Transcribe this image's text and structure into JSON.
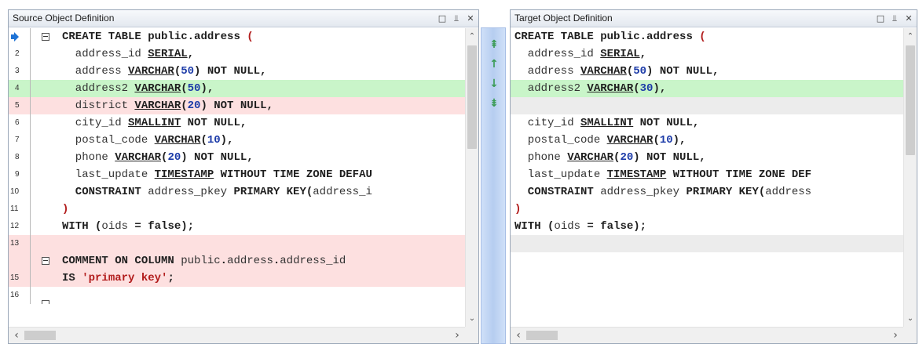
{
  "source_panel": {
    "title": "Source Object Definition"
  },
  "target_panel": {
    "title": "Target Object Definition"
  },
  "window_buttons": {
    "restore": "□",
    "pin": "⫫",
    "close": "✕"
  },
  "scroll": {
    "up": "⌃",
    "down": "⌄",
    "left": "‹",
    "right": "›"
  },
  "nav_buttons": {
    "first": "⇞",
    "prev": "↑",
    "next": "↓",
    "last": "⇟"
  },
  "colors": {
    "added": "#c9f5c9",
    "removed": "#fde0e0",
    "blank": "#ececec",
    "marker": "#1e73d6"
  },
  "source_lines": [
    {
      "num": "",
      "state": "normal",
      "fold": true,
      "marker": true,
      "segments": [
        {
          "t": "CREATE TABLE ",
          "c": "kw"
        },
        {
          "t": "public",
          "c": "kw"
        },
        {
          "t": ".",
          "c": "kw"
        },
        {
          "t": "address",
          "c": "kw"
        },
        {
          "t": " (",
          "c": "pr"
        }
      ]
    },
    {
      "num": "2",
      "state": "normal",
      "segments": [
        {
          "t": "  address_id ",
          "c": "id"
        },
        {
          "t": "SERIAL",
          "c": "ty"
        },
        {
          "t": ",",
          "c": "kw"
        }
      ]
    },
    {
      "num": "3",
      "state": "normal",
      "segments": [
        {
          "t": "  address ",
          "c": "id"
        },
        {
          "t": "VARCHAR",
          "c": "ty"
        },
        {
          "t": "(",
          "c": "kw"
        },
        {
          "t": "50",
          "c": "num"
        },
        {
          "t": ") NOT NULL,",
          "c": "kw"
        }
      ]
    },
    {
      "num": "4",
      "state": "added",
      "segments": [
        {
          "t": "  address2 ",
          "c": "id"
        },
        {
          "t": "VARCHAR",
          "c": "ty"
        },
        {
          "t": "(",
          "c": "kw"
        },
        {
          "t": "50",
          "c": "num"
        },
        {
          "t": "),",
          "c": "kw"
        }
      ]
    },
    {
      "num": "5",
      "state": "removed",
      "segments": [
        {
          "t": "  district ",
          "c": "id"
        },
        {
          "t": "VARCHAR",
          "c": "ty"
        },
        {
          "t": "(",
          "c": "kw"
        },
        {
          "t": "20",
          "c": "num"
        },
        {
          "t": ") NOT NULL,",
          "c": "kw"
        }
      ]
    },
    {
      "num": "6",
      "state": "normal",
      "segments": [
        {
          "t": "  city_id ",
          "c": "id"
        },
        {
          "t": "SMALLINT",
          "c": "ty"
        },
        {
          "t": " NOT NULL,",
          "c": "kw"
        }
      ]
    },
    {
      "num": "7",
      "state": "normal",
      "segments": [
        {
          "t": "  postal_code ",
          "c": "id"
        },
        {
          "t": "VARCHAR",
          "c": "ty"
        },
        {
          "t": "(",
          "c": "kw"
        },
        {
          "t": "10",
          "c": "num"
        },
        {
          "t": "),",
          "c": "kw"
        }
      ]
    },
    {
      "num": "8",
      "state": "normal",
      "segments": [
        {
          "t": "  phone ",
          "c": "id"
        },
        {
          "t": "VARCHAR",
          "c": "ty"
        },
        {
          "t": "(",
          "c": "kw"
        },
        {
          "t": "20",
          "c": "num"
        },
        {
          "t": ") NOT NULL,",
          "c": "kw"
        }
      ]
    },
    {
      "num": "9",
      "state": "normal",
      "segments": [
        {
          "t": "  last_update ",
          "c": "id"
        },
        {
          "t": "TIMESTAMP",
          "c": "ty"
        },
        {
          "t": " WITHOUT TIME ZONE DEFAU",
          "c": "kw"
        }
      ]
    },
    {
      "num": "10",
      "state": "normal",
      "segments": [
        {
          "t": "  CONSTRAINT ",
          "c": "kw"
        },
        {
          "t": "address_pkey",
          "c": "id"
        },
        {
          "t": " PRIMARY KEY(",
          "c": "kw"
        },
        {
          "t": "address_i",
          "c": "id"
        }
      ]
    },
    {
      "num": "11",
      "state": "normal",
      "segments": [
        {
          "t": ")",
          "c": "pr"
        }
      ]
    },
    {
      "num": "12",
      "state": "normal",
      "segments": [
        {
          "t": "WITH (",
          "c": "kw"
        },
        {
          "t": "oids",
          "c": "id"
        },
        {
          "t": " = false);",
          "c": "kw"
        }
      ]
    },
    {
      "num": "13",
      "state": "removed",
      "segments": []
    },
    {
      "num": "",
      "state": "removed",
      "fold": true,
      "segments": [
        {
          "t": "COMMENT ON COLUMN ",
          "c": "kw"
        },
        {
          "t": "public",
          "c": "id"
        },
        {
          "t": ".",
          "c": "kw"
        },
        {
          "t": "address",
          "c": "id"
        },
        {
          "t": ".",
          "c": "kw"
        },
        {
          "t": "address_id",
          "c": "id"
        }
      ]
    },
    {
      "num": "15",
      "state": "removed",
      "segments": [
        {
          "t": "IS ",
          "c": "kw"
        },
        {
          "t": "'primary key'",
          "c": "str"
        },
        {
          "t": ";",
          "c": "kw"
        }
      ]
    },
    {
      "num": "16",
      "state": "normal",
      "fold_partial": true,
      "segments": []
    }
  ],
  "target_lines": [
    {
      "state": "normal",
      "segments": [
        {
          "t": "CREATE TABLE ",
          "c": "kw"
        },
        {
          "t": "public",
          "c": "kw"
        },
        {
          "t": ".",
          "c": "kw"
        },
        {
          "t": "address",
          "c": "kw"
        },
        {
          "t": " (",
          "c": "pr"
        }
      ]
    },
    {
      "state": "normal",
      "segments": [
        {
          "t": "  address_id ",
          "c": "id"
        },
        {
          "t": "SERIAL",
          "c": "ty"
        },
        {
          "t": ",",
          "c": "kw"
        }
      ]
    },
    {
      "state": "normal",
      "segments": [
        {
          "t": "  address ",
          "c": "id"
        },
        {
          "t": "VARCHAR",
          "c": "ty"
        },
        {
          "t": "(",
          "c": "kw"
        },
        {
          "t": "50",
          "c": "num"
        },
        {
          "t": ") NOT NULL,",
          "c": "kw"
        }
      ]
    },
    {
      "state": "added",
      "segments": [
        {
          "t": "  address2 ",
          "c": "id"
        },
        {
          "t": "VARCHAR",
          "c": "ty"
        },
        {
          "t": "(",
          "c": "kw"
        },
        {
          "t": "30",
          "c": "num"
        },
        {
          "t": "),",
          "c": "kw"
        }
      ]
    },
    {
      "state": "blank",
      "segments": []
    },
    {
      "state": "normal",
      "segments": [
        {
          "t": "  city_id ",
          "c": "id"
        },
        {
          "t": "SMALLINT",
          "c": "ty"
        },
        {
          "t": " NOT NULL,",
          "c": "kw"
        }
      ]
    },
    {
      "state": "normal",
      "segments": [
        {
          "t": "  postal_code ",
          "c": "id"
        },
        {
          "t": "VARCHAR",
          "c": "ty"
        },
        {
          "t": "(",
          "c": "kw"
        },
        {
          "t": "10",
          "c": "num"
        },
        {
          "t": "),",
          "c": "kw"
        }
      ]
    },
    {
      "state": "normal",
      "segments": [
        {
          "t": "  phone ",
          "c": "id"
        },
        {
          "t": "VARCHAR",
          "c": "ty"
        },
        {
          "t": "(",
          "c": "kw"
        },
        {
          "t": "20",
          "c": "num"
        },
        {
          "t": ") NOT NULL,",
          "c": "kw"
        }
      ]
    },
    {
      "state": "normal",
      "segments": [
        {
          "t": "  last_update ",
          "c": "id"
        },
        {
          "t": "TIMESTAMP",
          "c": "ty"
        },
        {
          "t": " WITHOUT TIME ZONE DEF",
          "c": "kw"
        }
      ]
    },
    {
      "state": "normal",
      "segments": [
        {
          "t": "  CONSTRAINT ",
          "c": "kw"
        },
        {
          "t": "address_pkey",
          "c": "id"
        },
        {
          "t": " PRIMARY KEY(",
          "c": "kw"
        },
        {
          "t": "address",
          "c": "id"
        }
      ]
    },
    {
      "state": "normal",
      "segments": [
        {
          "t": ")",
          "c": "pr"
        }
      ]
    },
    {
      "state": "normal",
      "segments": [
        {
          "t": "WITH (",
          "c": "kw"
        },
        {
          "t": "oids",
          "c": "id"
        },
        {
          "t": " = false);",
          "c": "kw"
        }
      ]
    },
    {
      "state": "blank",
      "segments": []
    }
  ]
}
